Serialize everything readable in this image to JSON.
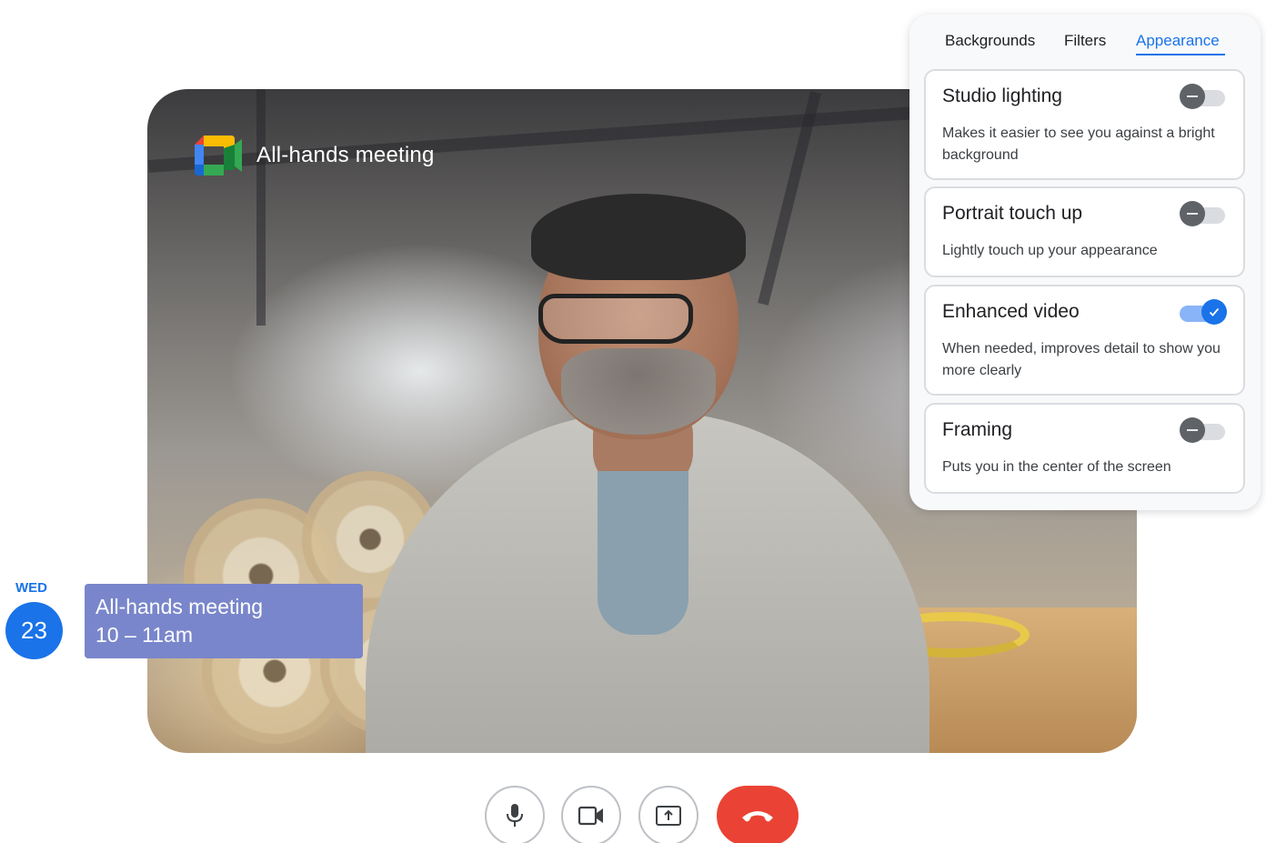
{
  "meeting": {
    "title": "All-hands meeting"
  },
  "calendar": {
    "weekday": "WED",
    "day": "23",
    "event_title": "All-hands meeting",
    "event_time": "10 – 11am"
  },
  "panel": {
    "tabs": [
      {
        "label": "Backgrounds",
        "active": false
      },
      {
        "label": "Filters",
        "active": false
      },
      {
        "label": "Appearance",
        "active": true
      }
    ],
    "cards": [
      {
        "title": "Studio lighting",
        "description": "Makes it easier to see you against a bright background",
        "enabled": false
      },
      {
        "title": "Portrait touch up",
        "description": "Lightly touch up your appearance",
        "enabled": false
      },
      {
        "title": "Enhanced video",
        "description": "When needed, improves detail to show you more clearly",
        "enabled": true
      },
      {
        "title": "Framing",
        "description": "Puts you in the center of the screen",
        "enabled": false
      }
    ]
  },
  "controls": {
    "icons": [
      "microphone-icon",
      "camera-icon",
      "present-screen-icon",
      "end-call-icon"
    ]
  },
  "colors": {
    "accent": "#1a73e8",
    "event_chip": "#7986cb",
    "end_call": "#ea4335"
  }
}
